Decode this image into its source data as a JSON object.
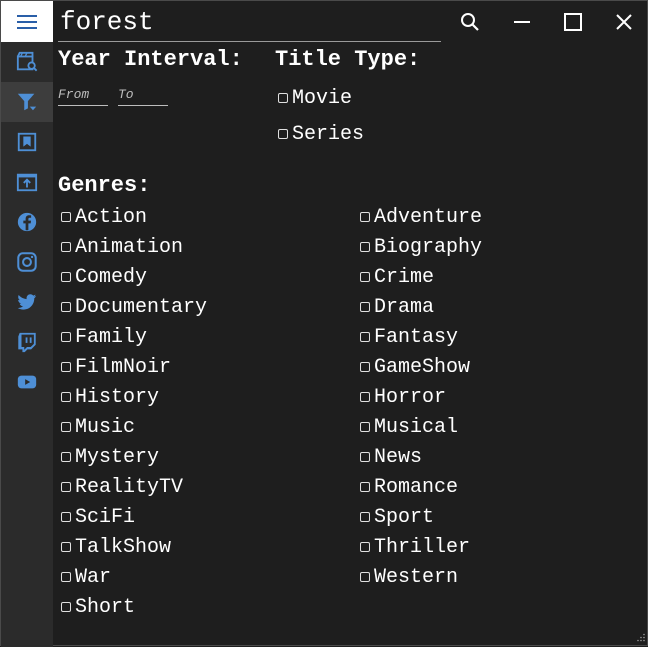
{
  "search": {
    "value": "forest"
  },
  "sidebar": {
    "items": [
      {
        "name": "movie-search"
      },
      {
        "name": "filter"
      },
      {
        "name": "bookmarks"
      },
      {
        "name": "export"
      },
      {
        "name": "facebook"
      },
      {
        "name": "instagram"
      },
      {
        "name": "twitter"
      },
      {
        "name": "twitch"
      },
      {
        "name": "youtube"
      }
    ],
    "accent": "#4e8fd6"
  },
  "filters": {
    "year_interval_label": "Year Interval:",
    "from_placeholder": "From",
    "to_placeholder": "To",
    "title_type_label": "Title Type:",
    "title_types": [
      "Movie",
      "Series"
    ],
    "genres_label": "Genres:",
    "genres_left": [
      "Action",
      "Animation",
      "Comedy",
      "Documentary",
      "Family",
      "FilmNoir",
      "History",
      "Music",
      "Mystery",
      "RealityTV",
      "SciFi",
      "TalkShow",
      "War",
      "Short"
    ],
    "genres_right": [
      "Adventure",
      "Biography",
      "Crime",
      "Drama",
      "Fantasy",
      "GameShow",
      "Horror",
      "Musical",
      "News",
      "Romance",
      "Sport",
      "Thriller",
      "Western"
    ]
  }
}
